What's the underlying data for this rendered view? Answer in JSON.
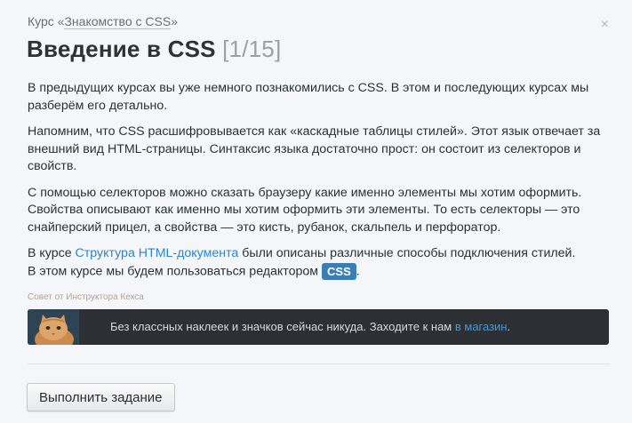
{
  "header": {
    "course_prefix": "Курс «",
    "course_name": "Знакомство с CSS",
    "course_suffix": "»",
    "title": "Введение в CSS",
    "counter": "[1/15]",
    "close_glyph": "×"
  },
  "content": {
    "p1": "В предыдущих курсах вы уже немного познакомились с CSS. В этом и последующих курсах мы разберём его детально.",
    "p2": "Напомним, что CSS расшифровывается как «каскадные таблицы стилей». Этот язык отвечает за внешний вид HTML-страницы. Синтаксис языка достаточно прост: он состоит из селекторов и свойств.",
    "p3": "С помощью селекторов можно сказать браузеру какие именно элементы мы хотим оформить. Свойства описывают как именно мы хотим оформить эти элементы. То есть селекторы — это снайперский прицел, а свойства — это кисть, рубанок, скальпель и перфоратор.",
    "p4_before": "В курсе ",
    "p4_link": "Структура HTML-документа",
    "p4_after": " были описаны различные способы подключения стилей.",
    "p5_before": "В этом курсе мы будем пользоваться редактором ",
    "p5_tag": "CSS",
    "p5_after": "."
  },
  "tip": {
    "caption": "Совет от Инструктора Кекса",
    "text_before": "Без классных наклеек и значков сейчас никуда. Заходите к нам ",
    "link": "в магазин",
    "text_after": "."
  },
  "footer": {
    "button_label": "Выполнить задание"
  },
  "colors": {
    "link": "#2a86c8",
    "tag_bg": "#3b7eb3",
    "banner_bg": "#2c3034"
  }
}
